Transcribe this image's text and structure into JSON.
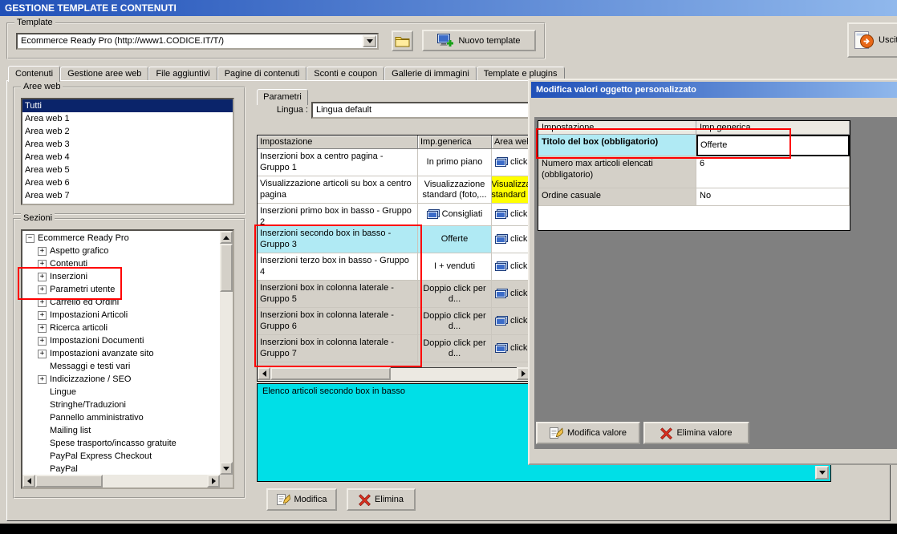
{
  "window": {
    "title": "GESTIONE TEMPLATE E CONTENUTI"
  },
  "colors": {
    "titlebar_start": "#2050b8",
    "titlebar_end": "#90b8ec",
    "selection": "#0a246a",
    "row_selected": "#b0eaf4",
    "highlight_yellow": "#ffff00",
    "info_cyan": "#00dfe7",
    "annotation_red": "#ff0000"
  },
  "template_bar": {
    "group_label": "Template",
    "combo_value": "Ecommerce Ready Pro (http://www1.CODICE.IT/T/)",
    "new_template_label": "Nuovo template",
    "exit_label": "Uscita"
  },
  "tabs": [
    "Contenuti",
    "Gestione aree web",
    "File aggiuntivi",
    "Pagine di contenuti",
    "Sconti e coupon",
    "Gallerie di immagini",
    "Template e plugins"
  ],
  "active_tab": "Contenuti",
  "aree_web": {
    "group_label": "Aree web",
    "items": [
      "Tutti",
      "Area web 1",
      "Area web 2",
      "Area web 3",
      "Area web 4",
      "Area web 5",
      "Area web 6",
      "Area web 7"
    ],
    "selected_index": 0
  },
  "sezioni": {
    "group_label": "Sezioni",
    "root_label": "Ecommerce Ready Pro",
    "items": [
      {
        "label": "Aspetto grafico",
        "expandable": true
      },
      {
        "label": "Contenuti",
        "expandable": true
      },
      {
        "label": "Inserzioni",
        "expandable": true
      },
      {
        "label": "Parametri utente",
        "expandable": true
      },
      {
        "label": "Carrello ed Ordini",
        "expandable": true
      },
      {
        "label": "Impostazioni Articoli",
        "expandable": true
      },
      {
        "label": "Ricerca articoli",
        "expandable": true
      },
      {
        "label": "Impostazioni Documenti",
        "expandable": true
      },
      {
        "label": "Impostazioni avanzate sito",
        "expandable": true
      },
      {
        "label": "Messaggi e testi vari",
        "expandable": false
      },
      {
        "label": "Indicizzazione / SEO",
        "expandable": true
      },
      {
        "label": "Lingue",
        "expandable": false
      },
      {
        "label": "Stringhe/Traduzioni",
        "expandable": false
      },
      {
        "label": "Pannello amministrativo",
        "expandable": false
      },
      {
        "label": "Mailing list",
        "expandable": false
      },
      {
        "label": "Spese trasporto/incasso gratuite",
        "expandable": false
      },
      {
        "label": "PayPal Express Checkout",
        "expandable": false
      },
      {
        "label": "PayPal",
        "expandable": false
      }
    ]
  },
  "parametri": {
    "tab_label": "Parametri",
    "lingua_label": "Lingua :",
    "lingua_value": "Lingua default",
    "table": {
      "headers": [
        "Impostazione",
        "Imp.generica",
        "Area web"
      ],
      "rows": [
        {
          "name": "Inserzioni box a centro pagina - Gruppo 1",
          "value": "In primo piano",
          "area": "click",
          "state": "normal"
        },
        {
          "name": "Visualizzazione articoli su box a centro pagina",
          "value": "Visualizzazione standard (foto,...",
          "area": "Visualizza standard",
          "state": "normal",
          "area_style": "yellow"
        },
        {
          "name": "Inserzioni primo box in basso - Gruppo 2",
          "value": "Consigliati",
          "area": "click",
          "state": "normal",
          "value_icon": true
        },
        {
          "name": "Inserzioni secondo box in basso - Gruppo 3",
          "value": "Offerte",
          "area": "click",
          "state": "selected"
        },
        {
          "name": "Inserzioni terzo box in basso - Gruppo 4",
          "value": "I + venduti",
          "area": "click",
          "state": "normal"
        },
        {
          "name": "Inserzioni box in colonna laterale - Gruppo 5",
          "value": "Doppio click per d...",
          "area": "click",
          "state": "unset"
        },
        {
          "name": "Inserzioni box in colonna laterale - Gruppo 6",
          "value": "Doppio click per d...",
          "area": "click",
          "state": "unset"
        },
        {
          "name": "Inserzioni box in colonna laterale - Gruppo 7",
          "value": "Doppio click per d...",
          "area": "click",
          "state": "unset"
        }
      ]
    },
    "description": "Elenco articoli secondo box in basso",
    "modifica_label": "Modifica",
    "elimina_label": "Elimina"
  },
  "modal": {
    "title": "Modifica valori oggetto personalizzato",
    "headers": [
      "Impostazione",
      "Imp.generica"
    ],
    "rows": [
      {
        "name": "Titolo del box (obbligatorio)",
        "value": "Offerte",
        "state": "editing"
      },
      {
        "name": "Numero max articoli elencati (obbligatorio)",
        "value": "6",
        "state": "normal"
      },
      {
        "name": "Ordine casuale",
        "value": "No",
        "state": "normal"
      }
    ],
    "modifica_label": "Modifica valore",
    "elimina_label": "Elimina valore"
  }
}
